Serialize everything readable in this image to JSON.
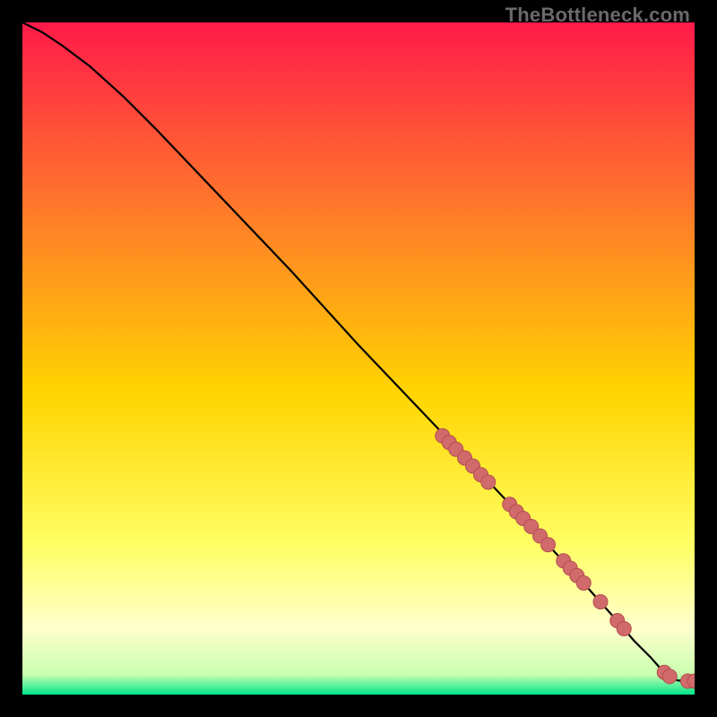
{
  "watermark": "TheBottleneck.com",
  "colors": {
    "page_bg": "#000000",
    "gradient_top": "#ff1a4a",
    "gradient_mid1": "#ff7a2a",
    "gradient_mid2": "#ffd400",
    "gradient_mid3": "#ffff66",
    "gradient_pale": "#ffffcc",
    "gradient_green": "#00e58a",
    "curve": "#000000",
    "marker_fill": "#d16a6a",
    "marker_stroke": "#b34f4f"
  },
  "chart_data": {
    "type": "line",
    "title": "",
    "xlabel": "",
    "ylabel": "",
    "xlim": [
      0,
      100
    ],
    "ylim": [
      0,
      100
    ],
    "grid": false,
    "legend": false,
    "series": [
      {
        "name": "curve",
        "x": [
          0,
          3,
          6,
          10,
          15,
          20,
          30,
          40,
          50,
          60,
          70,
          78,
          84,
          88,
          91,
          93.5,
          95,
          96,
          97.5,
          100
        ],
        "y": [
          100,
          98.5,
          96.5,
          93.5,
          89,
          84,
          73.5,
          63,
          52,
          41.5,
          31,
          22.5,
          16,
          11.5,
          8,
          5.5,
          3.8,
          2.7,
          2.1,
          2.0
        ]
      }
    ],
    "markers": {
      "name": "highlighted-points",
      "points": [
        {
          "x": 62.5,
          "y": 38.5
        },
        {
          "x": 63.5,
          "y": 37.5
        },
        {
          "x": 64.5,
          "y": 36.5
        },
        {
          "x": 65.8,
          "y": 35.2
        },
        {
          "x": 67.0,
          "y": 34.0
        },
        {
          "x": 68.2,
          "y": 32.7
        },
        {
          "x": 69.3,
          "y": 31.6
        },
        {
          "x": 72.5,
          "y": 28.3
        },
        {
          "x": 73.5,
          "y": 27.2
        },
        {
          "x": 74.5,
          "y": 26.2
        },
        {
          "x": 75.7,
          "y": 25.0
        },
        {
          "x": 77.0,
          "y": 23.6
        },
        {
          "x": 78.2,
          "y": 22.3
        },
        {
          "x": 80.5,
          "y": 19.9
        },
        {
          "x": 81.5,
          "y": 18.8
        },
        {
          "x": 82.5,
          "y": 17.7
        },
        {
          "x": 83.5,
          "y": 16.6
        },
        {
          "x": 86.0,
          "y": 13.8
        },
        {
          "x": 88.5,
          "y": 11.0
        },
        {
          "x": 89.5,
          "y": 9.8
        },
        {
          "x": 95.5,
          "y": 3.3
        },
        {
          "x": 96.3,
          "y": 2.7
        },
        {
          "x": 99.0,
          "y": 2.0
        },
        {
          "x": 100.0,
          "y": 2.0
        }
      ],
      "radius": 8
    }
  }
}
